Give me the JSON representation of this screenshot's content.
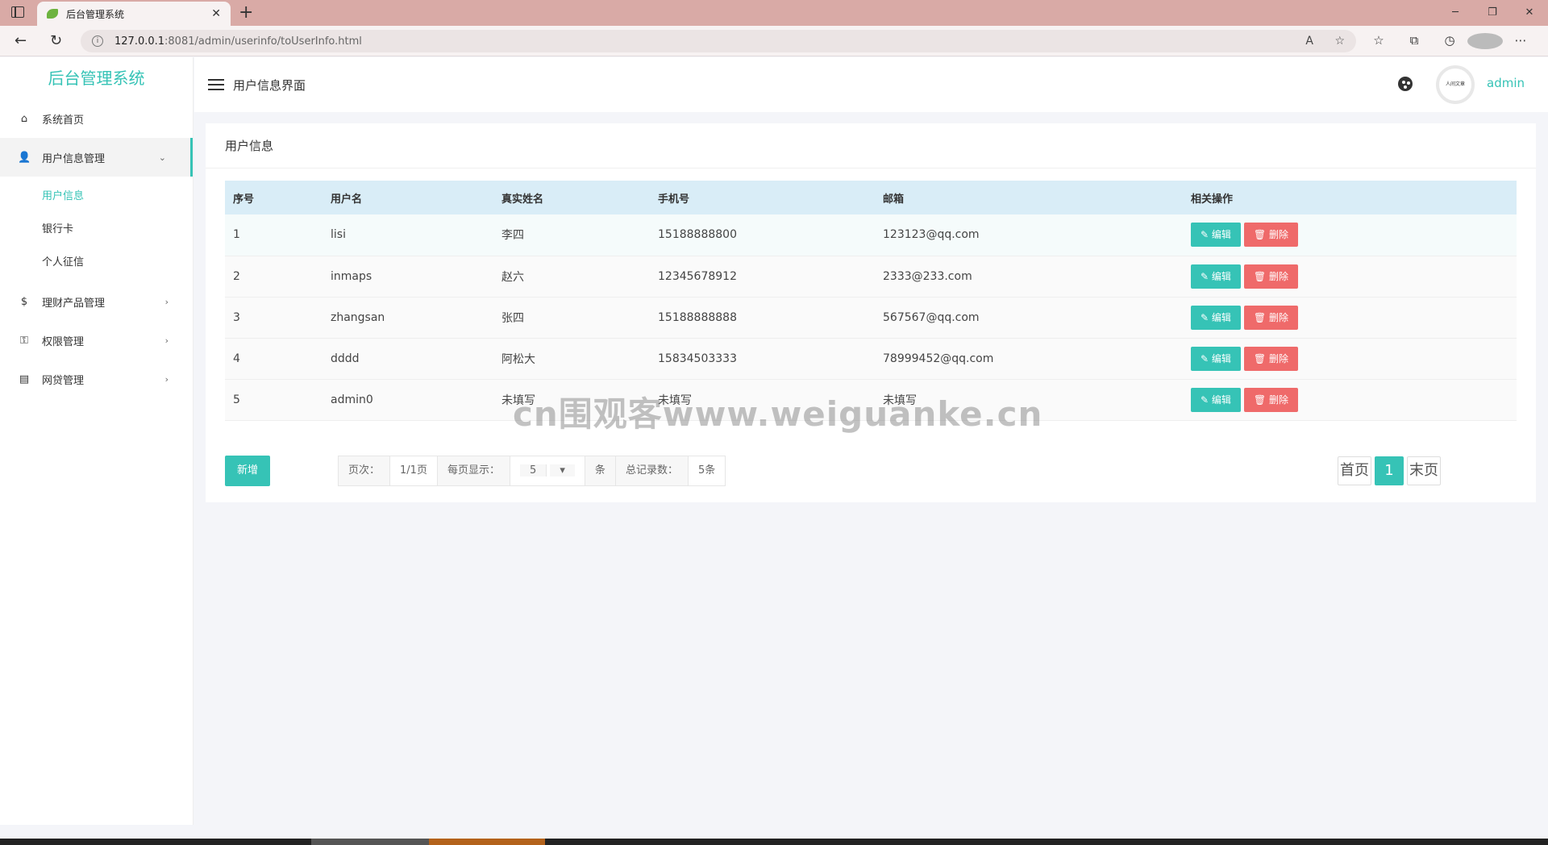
{
  "browser": {
    "tab_title": "后台管理系统",
    "url_host": "127.0.0.1",
    "url_rest": ":8081/admin/userinfo/toUserInfo.html"
  },
  "sidebar": {
    "logo": "后台管理系统",
    "items": [
      {
        "label": "系统首页",
        "icon": "home-icon"
      },
      {
        "label": "用户信息管理",
        "icon": "user-settings-icon"
      },
      {
        "label": "理财产品管理",
        "icon": "dollar-icon"
      },
      {
        "label": "权限管理",
        "icon": "key-icon"
      },
      {
        "label": "网贷管理",
        "icon": "message-icon"
      }
    ],
    "submenu": [
      {
        "label": "用户信息"
      },
      {
        "label": "银行卡"
      },
      {
        "label": "个人征信"
      }
    ]
  },
  "header": {
    "title": "用户信息界面",
    "avatar_text": "人间文章",
    "username": "admin"
  },
  "card": {
    "title": "用户信息",
    "columns": [
      "序号",
      "用户名",
      "真实姓名",
      "手机号",
      "邮箱",
      "相关操作"
    ],
    "rows": [
      {
        "id": "1",
        "username": "lisi",
        "realname": "李四",
        "phone": "15188888800",
        "email": "123123@qq.com"
      },
      {
        "id": "2",
        "username": "inmaps",
        "realname": "赵六",
        "phone": "12345678912",
        "email": "2333@233.com"
      },
      {
        "id": "3",
        "username": "zhangsan",
        "realname": "张四",
        "phone": "15188888888",
        "email": "567567@qq.com"
      },
      {
        "id": "4",
        "username": "dddd",
        "realname": "阿松大",
        "phone": "15834503333",
        "email": "78999452@qq.com"
      },
      {
        "id": "5",
        "username": "admin0",
        "realname": "未填写",
        "phone": "未填写",
        "email": "未填写"
      }
    ],
    "edit_label": "编辑",
    "delete_label": "删除",
    "add_label": "新增"
  },
  "pager": {
    "page_label": "页次：",
    "page_value": "1/1页",
    "per_page_label": "每页显示：",
    "per_page_value": "5",
    "unit": "条",
    "total_label": "总记录数：",
    "total_value": "5条",
    "first": "首页",
    "current": "1",
    "last": "末页"
  },
  "watermark": "cn围观客www.weiguanke.cn"
}
